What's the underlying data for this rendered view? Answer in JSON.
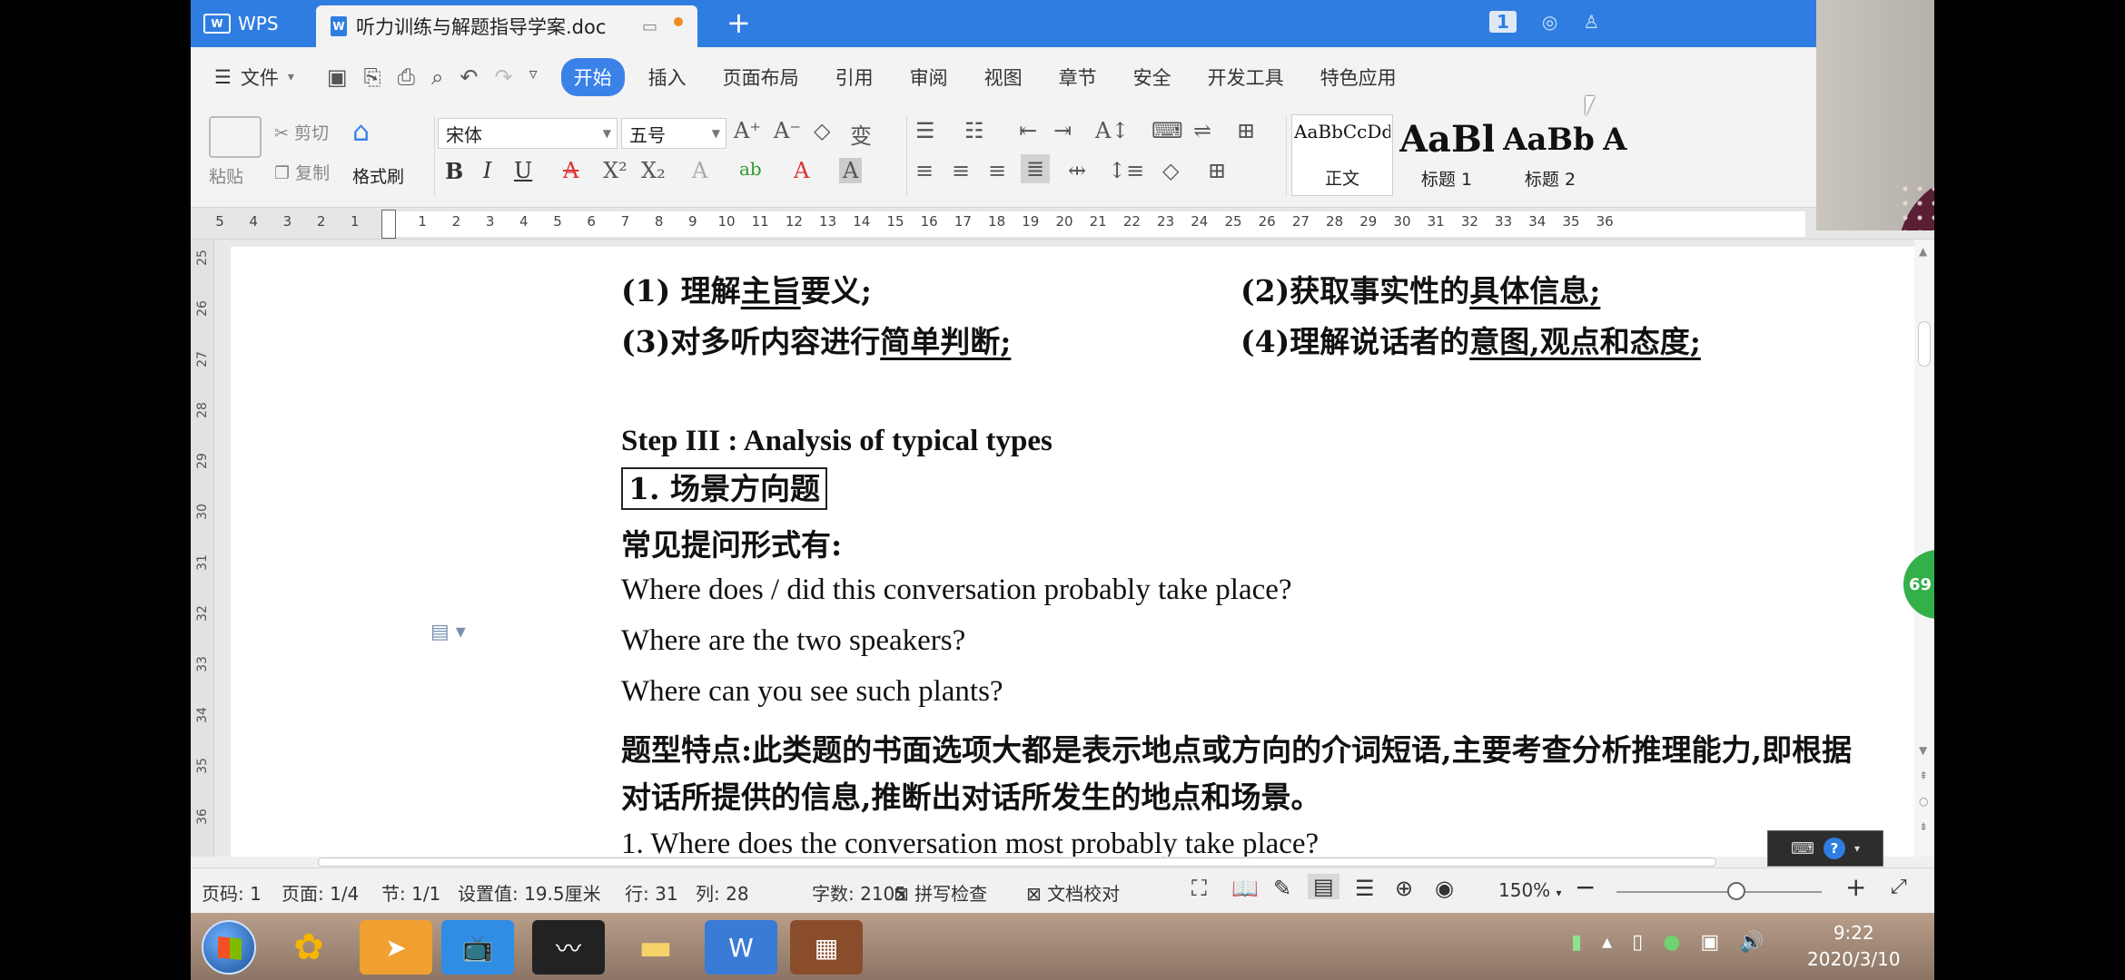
{
  "titlebar": {
    "app_name": "WPS",
    "doc_tab": "听力训练与解题指导学案.doc",
    "badge": "1"
  },
  "menubar": {
    "file_label": "文件",
    "tabs": [
      "开始",
      "插入",
      "页面布局",
      "引用",
      "审阅",
      "视图",
      "章节",
      "安全",
      "开发工具",
      "特色应用"
    ],
    "active_tab": "开始",
    "search_fragment": "查"
  },
  "ribbon": {
    "paste": "粘贴",
    "cut": "剪切",
    "copy": "复制",
    "format_painter": "格式刷",
    "font_name": "宋体",
    "font_size": "五号",
    "styles": [
      {
        "sample": "AaBbCcDd",
        "label": "正文"
      },
      {
        "sample": "AaBl",
        "label": "标题 1"
      },
      {
        "sample": "AaBb(",
        "label": "标题 2"
      },
      {
        "sample": "A",
        "label": ""
      }
    ]
  },
  "ruler": {
    "left_numbers": [
      "5",
      "4",
      "3",
      "2",
      "1"
    ],
    "right_numbers": [
      "1",
      "2",
      "3",
      "4",
      "5",
      "6",
      "7",
      "8",
      "9",
      "10",
      "11",
      "12",
      "13",
      "14",
      "15",
      "16",
      "17",
      "18",
      "19",
      "20",
      "21",
      "22",
      "23",
      "24",
      "25",
      "26",
      "27",
      "28",
      "29",
      "30",
      "31",
      "32",
      "33",
      "34",
      "35",
      "36"
    ],
    "vertical_numbers": [
      "25",
      "26",
      "27",
      "28",
      "29",
      "30",
      "31",
      "32",
      "33",
      "34",
      "35",
      "36"
    ]
  },
  "document": {
    "line1_left_a": "(1)  理解",
    "line1_left_u": "主旨",
    "line1_left_b": "要义;",
    "line1_right_a": "(2)获取事实性的",
    "line1_right_u": "具体信息;",
    "line2_left_a": "(3)对多听内容进行",
    "line2_left_u": "简单判断;",
    "line2_right_a": "(4)理解说话者的",
    "line2_right_u": "意图,观点和态度;",
    "step_heading": "Step III : Analysis of typical types",
    "section_box": "1.  场景方向题",
    "common_forms": "常见提问形式有:",
    "q1": "Where does / did this conversation probably take place?",
    "q2": "Where are the two speakers?",
    "q3": "Where can you see such plants?",
    "feature_line1": "题型特点:此类题的书面选项大都是表示地点或方向的介词短语,主要考查分析推理能力,即根据",
    "feature_line2": "对话所提供的信息,推断出对话所发生的地点和场景。",
    "example_q": "1. Where does the conversation most probably take place?",
    "side_badge": "69"
  },
  "statusbar": {
    "page_code": "页码: 1",
    "page": "页面: 1/4",
    "section": "节: 1/1",
    "setting": "设置值: 19.5厘米",
    "row": "行: 31",
    "col": "列: 28",
    "word_count": "字数: 2105",
    "spell_check": "拼写检查",
    "doc_check": "文档校对",
    "zoom": "150%"
  },
  "taskbar": {
    "time": "9:22",
    "date": "2020/3/10"
  },
  "colors": {
    "titlebar": "#2f7de1",
    "active_tab": "#3b82e8",
    "side_badge": "#34b04a"
  }
}
